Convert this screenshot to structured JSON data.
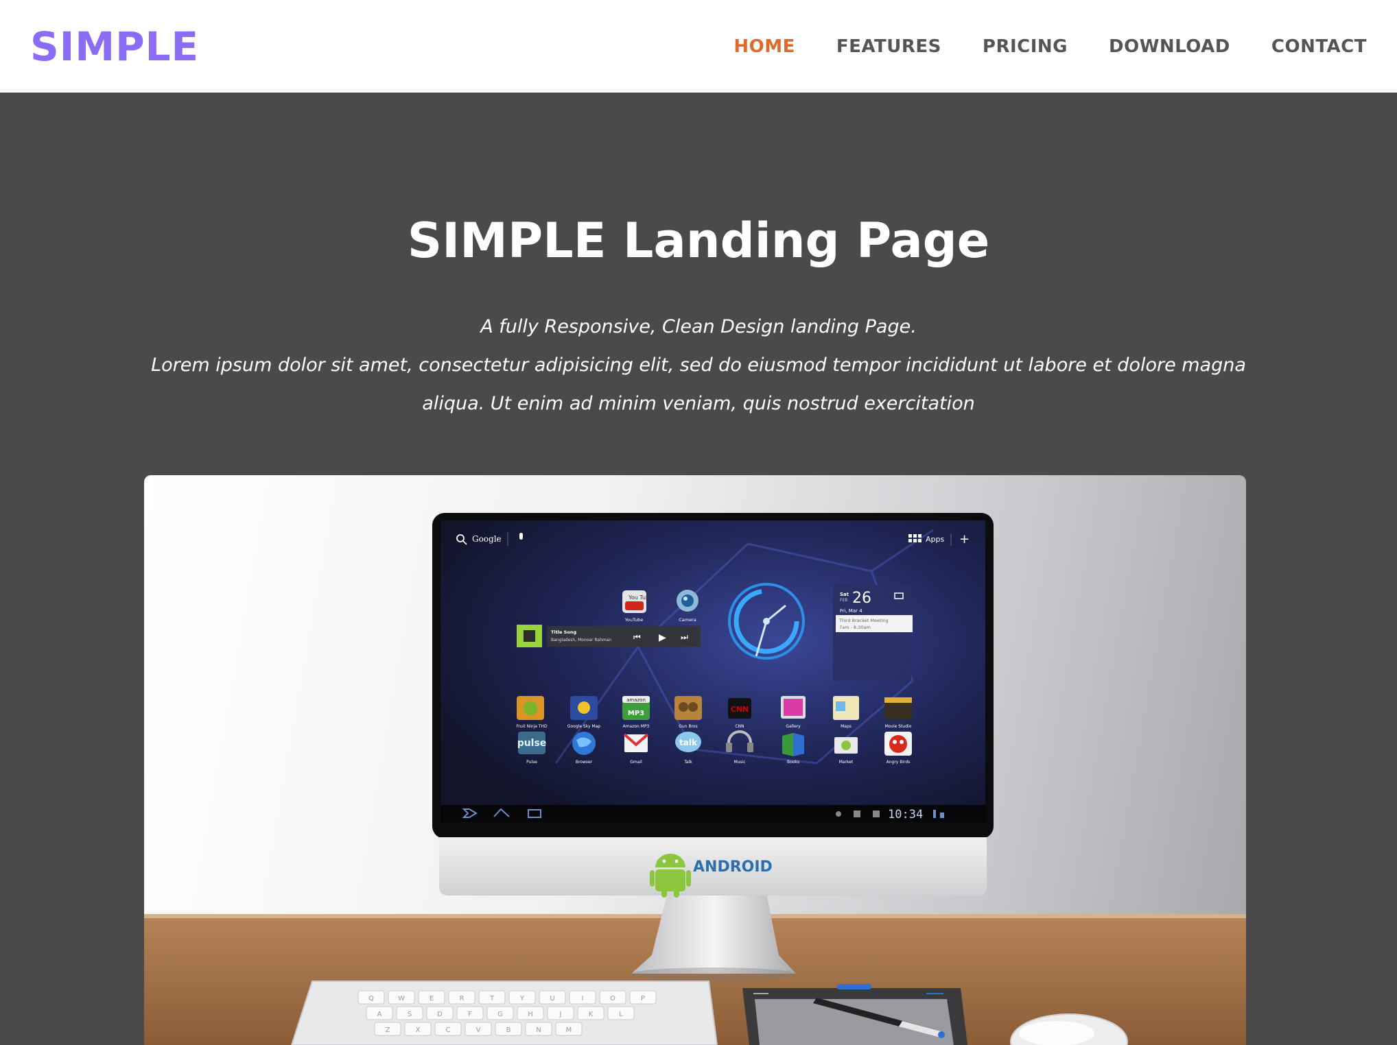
{
  "brand": {
    "logo_text": "SIMPLE",
    "accent_color": "#8b6cf5"
  },
  "nav": {
    "active_color": "#e06a2b",
    "items": [
      {
        "label": "HOME",
        "active": true
      },
      {
        "label": "FEATURES",
        "active": false
      },
      {
        "label": "PRICING",
        "active": false
      },
      {
        "label": "DOWNLOAD",
        "active": false
      },
      {
        "label": "CONTACT",
        "active": false
      }
    ]
  },
  "hero": {
    "title": "SIMPLE Landing Page",
    "tagline": "A fully Responsive, Clean Design landing Page.",
    "description": "Lorem ipsum dolor sit amet, consectetur adipisicing elit, sed do eiusmod tempor incididunt ut labore et dolore magna aliqua. Ut enim ad minim veniam, quis nostrud exercitation"
  },
  "showcase": {
    "screen": {
      "search_label": "Google",
      "apps_label": "Apps",
      "music_widget": {
        "title": "Title Song",
        "artist": "Bangladesh, Monoar Rahman"
      },
      "calendar": {
        "day_name": "Sat",
        "month": "FEB",
        "day_number": "26",
        "date_line": "Fri, Mar 4",
        "event": "Third Bracket Meeting",
        "event_time": "7am - 8:30am"
      },
      "clock_time": "10:34",
      "top_apps": [
        "YouTube",
        "Camera"
      ],
      "app_grid": [
        "Fruit Ninja THD",
        "Google Sky Map",
        "Amazon MP3",
        "Gun Bros",
        "CNN",
        "Gallery",
        "Maps",
        "Movie Studio",
        "Pulse",
        "Browser",
        "Gmail",
        "Talk",
        "Music",
        "Books",
        "Market",
        "Angry Birds"
      ],
      "icon_texts": {
        "youtube": "You Tube",
        "amazon": "amazon",
        "mp3": "MP3",
        "cnn": "CNN",
        "pulse": "pulse",
        "talk": "talk"
      }
    },
    "monitor_brand": "ANDROID",
    "keyboard_keys": [
      "Q",
      "W",
      "E",
      "R",
      "T",
      "Y",
      "U",
      "I",
      "O",
      "P",
      "A",
      "S",
      "D",
      "F",
      "G",
      "H",
      "J",
      "K",
      "L",
      "Z",
      "X",
      "C",
      "V",
      "B",
      "N",
      "M"
    ]
  }
}
